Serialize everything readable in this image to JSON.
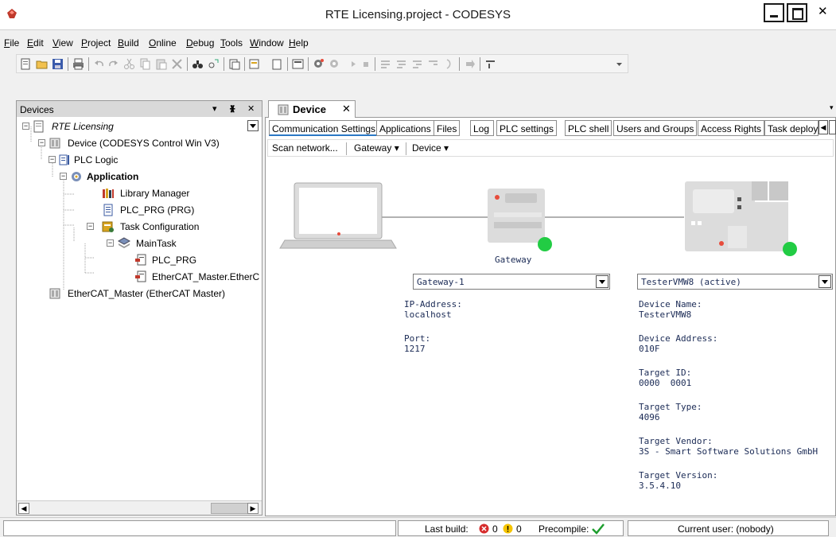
{
  "window": {
    "title": "RTE Licensing.project - CODESYS"
  },
  "menu": [
    "File",
    "Edit",
    "View",
    "Project",
    "Build",
    "Online",
    "Debug",
    "Tools",
    "Window",
    "Help"
  ],
  "toolbar": {
    "icons": [
      "new-project-icon",
      "open-project-icon",
      "save-icon",
      "print-icon",
      "undo-icon",
      "redo-icon",
      "cut-icon",
      "copy-icon",
      "paste-icon",
      "delete-icon",
      "find-icon",
      "replace-icon",
      "bookmark-icon",
      "insert-icon",
      "add-object-icon",
      "add-folder-icon",
      "build-icon",
      "login-icon",
      "logout-icon",
      "start-icon",
      "stop-icon",
      "step-over-icon",
      "step-into-icon",
      "step-out-icon",
      "run-to-cursor-icon",
      "toggle-breakpoint-icon",
      "show-next-statement-icon",
      "toolbar-overflow-icon"
    ]
  },
  "devices_panel": {
    "title": "Devices",
    "ctrl_dropdown": "▾",
    "ctrl_pin": "ᚕ",
    "ctrl_close": "✕",
    "tree": [
      {
        "label": "RTE Licensing",
        "icon": "project-icon"
      },
      {
        "label": "Device (CODESYS Control Win V3)",
        "icon": "device-icon"
      },
      {
        "label": "PLC Logic",
        "icon": "plc-logic-icon"
      },
      {
        "label": "Application",
        "icon": "application-gear-icon"
      },
      {
        "label": "Library Manager",
        "icon": "library-manager-icon"
      },
      {
        "label": "PLC_PRG (PRG)",
        "icon": "pou-icon"
      },
      {
        "label": "Task Configuration",
        "icon": "task-configuration-icon"
      },
      {
        "label": "MainTask",
        "icon": "task-icon"
      },
      {
        "label": "PLC_PRG",
        "icon": "program-call-icon"
      },
      {
        "label": "EtherCAT_Master.EtherC",
        "icon": "program-call-icon"
      },
      {
        "label": "EtherCAT_Master (EtherCAT Master)",
        "icon": "device-icon"
      }
    ]
  },
  "editor": {
    "tab_label": "Device",
    "tab_close": "✕",
    "subtabs": [
      "Communication Settings",
      "Applications",
      "Files",
      "Log",
      "PLC settings",
      "PLC shell",
      "Users and Groups",
      "Access Rights",
      "Task deploy"
    ],
    "commands": {
      "scan": "Scan network...",
      "gateway": "Gateway ▾",
      "device": "Device ▾"
    },
    "gateway_caption": "Gateway",
    "gateway_combo": "Gateway-1",
    "device_combo": "TesterVMW8 (active)",
    "gateway_fields": [
      {
        "label": "IP-Address:",
        "value": "localhost"
      },
      {
        "label": "Port:",
        "value": "1217"
      }
    ],
    "device_fields": [
      {
        "label": "Device Name:",
        "value": "TesterVMW8"
      },
      {
        "label": "Device Address:",
        "value": "010F"
      },
      {
        "label": "Target ID:",
        "value": "0000  0001"
      },
      {
        "label": "Target Type:",
        "value": "4096"
      },
      {
        "label": "Target Vendor:",
        "value": "3S - Smart Software Solutions GmbH"
      },
      {
        "label": "Target Version:",
        "value": "3.5.4.10"
      }
    ],
    "status_colors": {
      "online": "#22cc44"
    }
  },
  "statusbar": {
    "last_build_label": "Last build:",
    "errors": "0",
    "warnings": "0",
    "precompile_label": "Precompile:",
    "current_user": "Current user: (nobody)"
  }
}
